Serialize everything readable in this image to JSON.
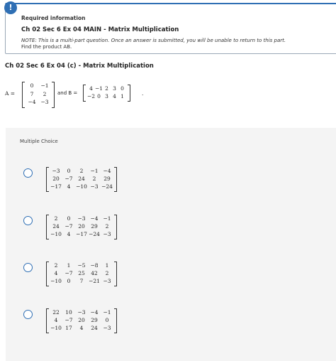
{
  "info": {
    "icon": "!",
    "required_label": "Required information",
    "exercise_title": "Ch 02 Sec 6 Ex 04 MAIN - Matrix Multiplication",
    "note": "NOTE: This is a multi-part question. Once an answer is submitted, you will be unable to return to this part.",
    "instruction": "Find the product AB."
  },
  "question": {
    "title": "Ch 02 Sec 6 Ex 04 (c) - Matrix Multiplication",
    "a_label": "A =",
    "and_label": "and B =",
    "end_punct": ".",
    "matrix_a": [
      [
        "0",
        "−1"
      ],
      [
        "7",
        "2"
      ],
      [
        "−4",
        "−3"
      ]
    ],
    "matrix_b": [
      [
        "4",
        "−1",
        "2",
        "3",
        "0"
      ],
      [
        "−2",
        "0",
        "3",
        "4",
        "1"
      ]
    ]
  },
  "multiple_choice": {
    "label": "Multiple Choice",
    "options": [
      {
        "rows": [
          [
            "−3",
            "0",
            "2",
            "−1",
            "−4"
          ],
          [
            "20",
            "−7",
            "24",
            "2",
            "29"
          ],
          [
            "−17",
            "4",
            "−10",
            "−3",
            "−24"
          ]
        ]
      },
      {
        "rows": [
          [
            "2",
            "0",
            "−3",
            "−4",
            "−1"
          ],
          [
            "24",
            "−7",
            "20",
            "29",
            "2"
          ],
          [
            "−10",
            "4",
            "−17",
            "−24",
            "−3"
          ]
        ]
      },
      {
        "rows": [
          [
            "2",
            "1",
            "−5",
            "−8",
            "1"
          ],
          [
            "4",
            "−7",
            "25",
            "42",
            "2"
          ],
          [
            "−10",
            "0",
            "7",
            "−21",
            "−3"
          ]
        ]
      },
      {
        "rows": [
          [
            "22",
            "10",
            "−3",
            "−4",
            "−1"
          ],
          [
            "4",
            "−7",
            "20",
            "29",
            "0"
          ],
          [
            "−10",
            "17",
            "4",
            "24",
            "−3"
          ]
        ]
      }
    ]
  },
  "colors": {
    "accent": "#2f6fb4",
    "panel": "#f4f4f4"
  }
}
